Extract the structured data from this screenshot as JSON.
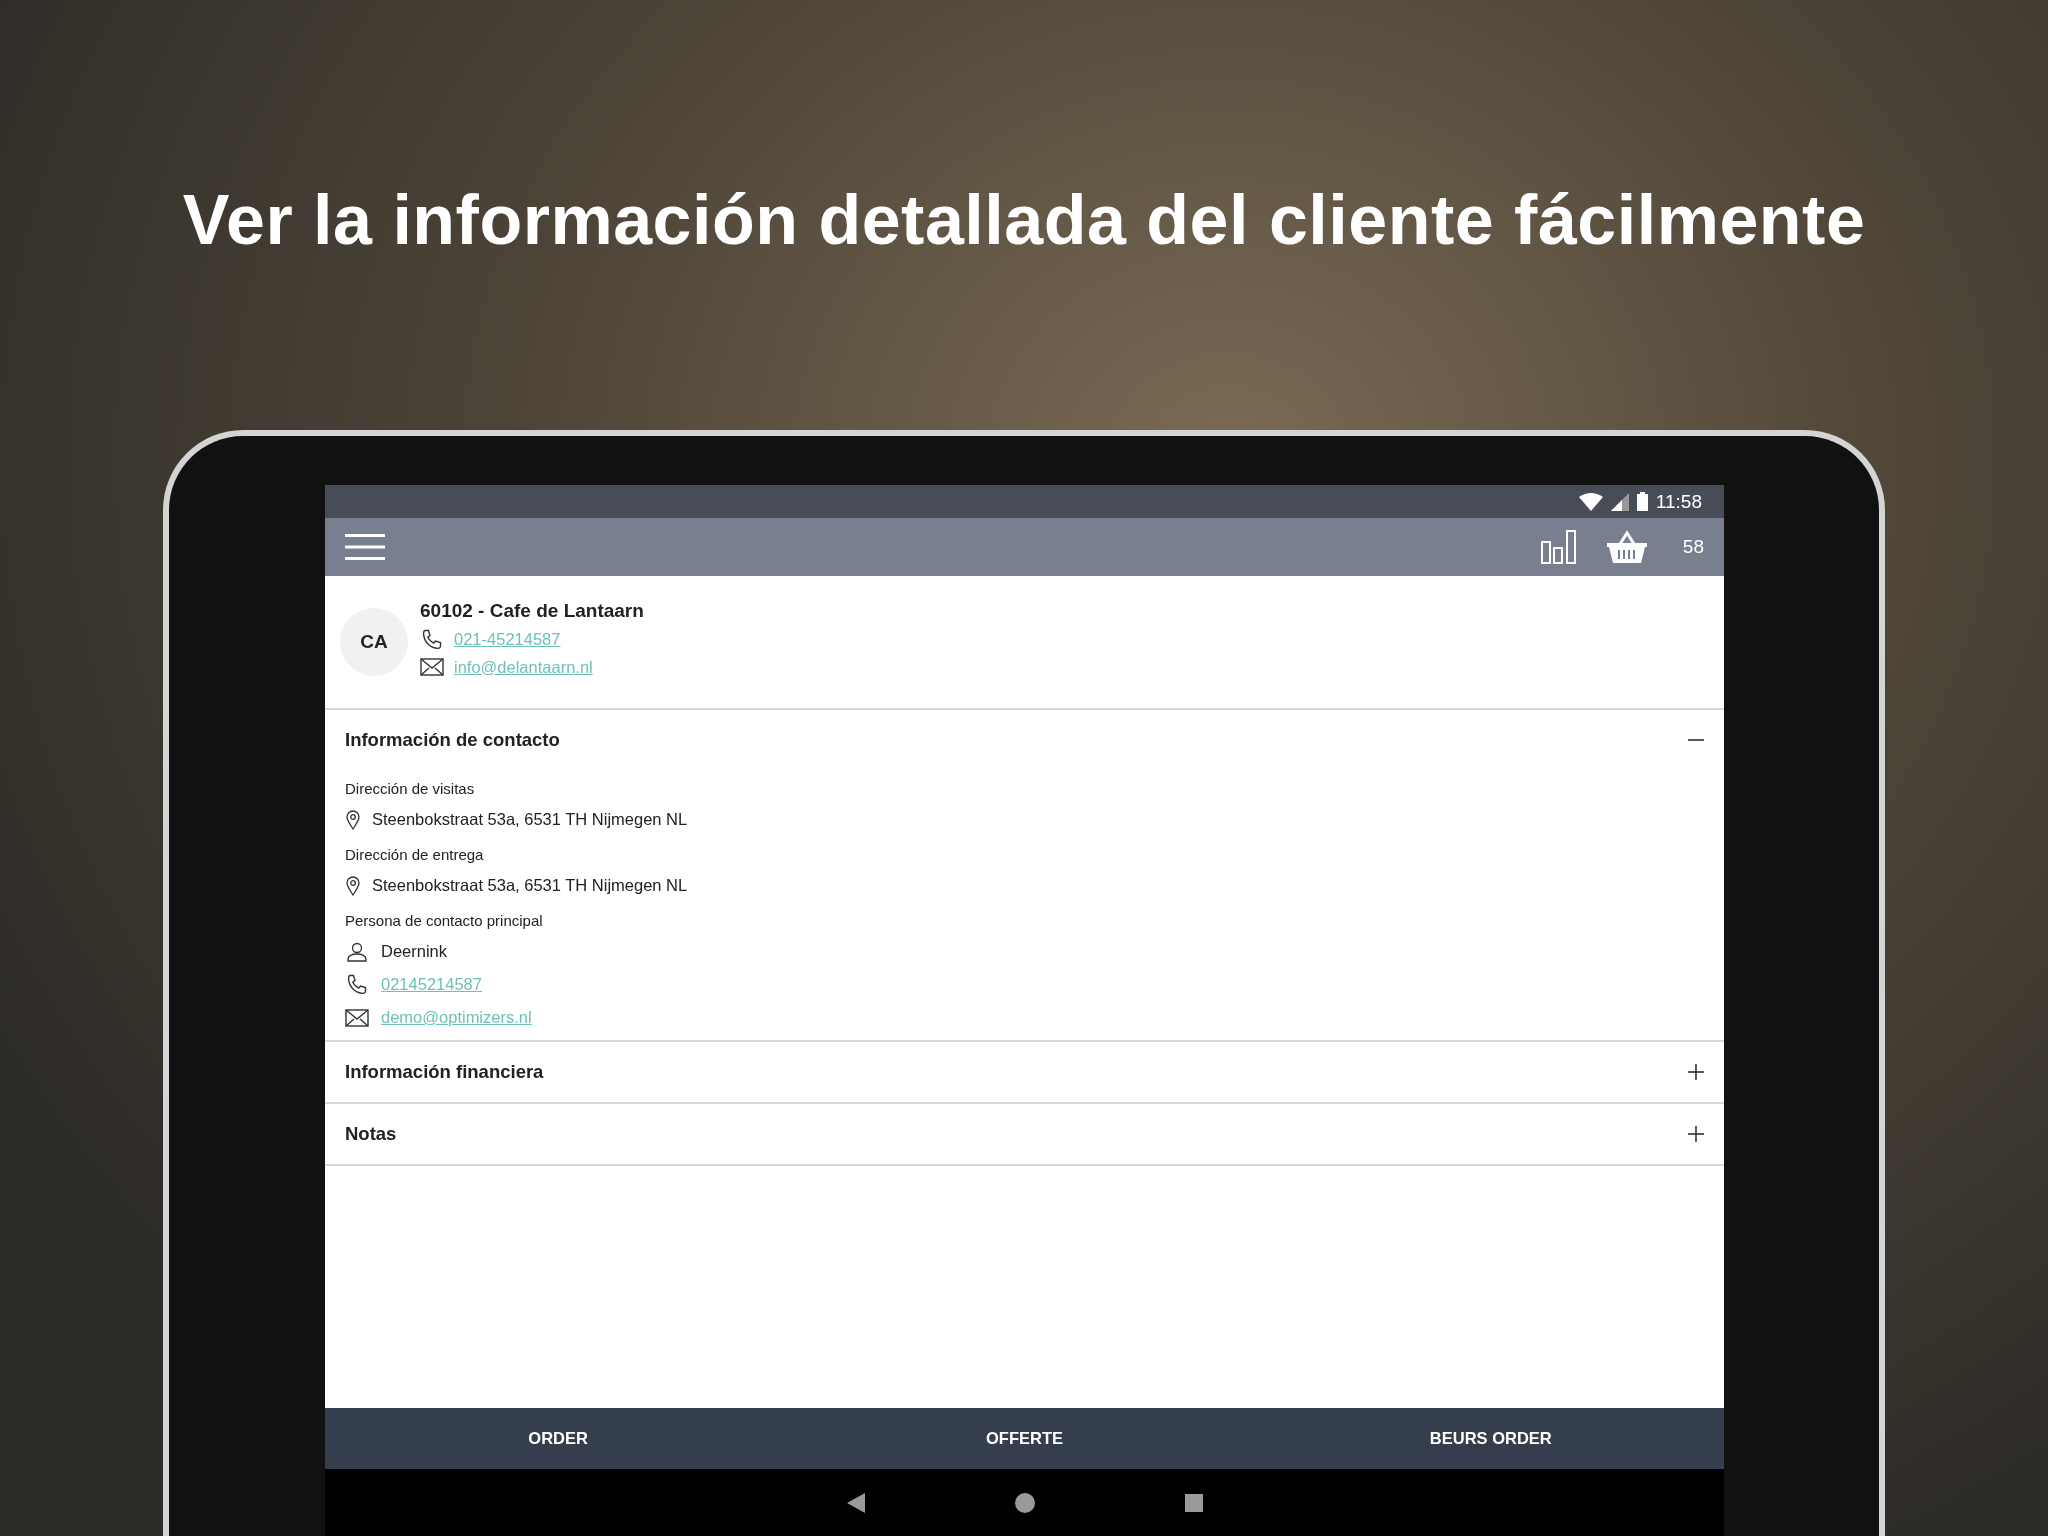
{
  "headline": "Ver la información detallada del cliente fácilmente",
  "status_bar": {
    "time": "11:58"
  },
  "toolbar": {
    "cart_count": "58"
  },
  "customer": {
    "initials": "CA",
    "title": "60102 - Cafe de Lantaarn",
    "phone": "021-45214587",
    "email": "info@delantaarn.nl"
  },
  "sections": [
    {
      "title": "Información de contacto",
      "expanded": true,
      "groups": [
        {
          "label": "Dirección de visitas",
          "lines": [
            {
              "kind": "address",
              "text": "Steenbokstraat 53a, 6531 TH Nijmegen NL"
            }
          ]
        },
        {
          "label": "Dirección de entrega",
          "lines": [
            {
              "kind": "address",
              "text": "Steenbokstraat 53a, 6531 TH Nijmegen NL"
            }
          ]
        },
        {
          "label": "Persona de contacto principal",
          "lines": [
            {
              "kind": "person",
              "text": "Deernink"
            },
            {
              "kind": "phone",
              "text": "02145214587"
            },
            {
              "kind": "email",
              "text": "demo@optimizers.nl"
            }
          ]
        }
      ]
    },
    {
      "title": "Información financiera",
      "expanded": false
    },
    {
      "title": "Notas",
      "expanded": false
    }
  ],
  "bottom_bar": [
    "ORDER",
    "OFFERTE",
    "BEURS ORDER"
  ]
}
